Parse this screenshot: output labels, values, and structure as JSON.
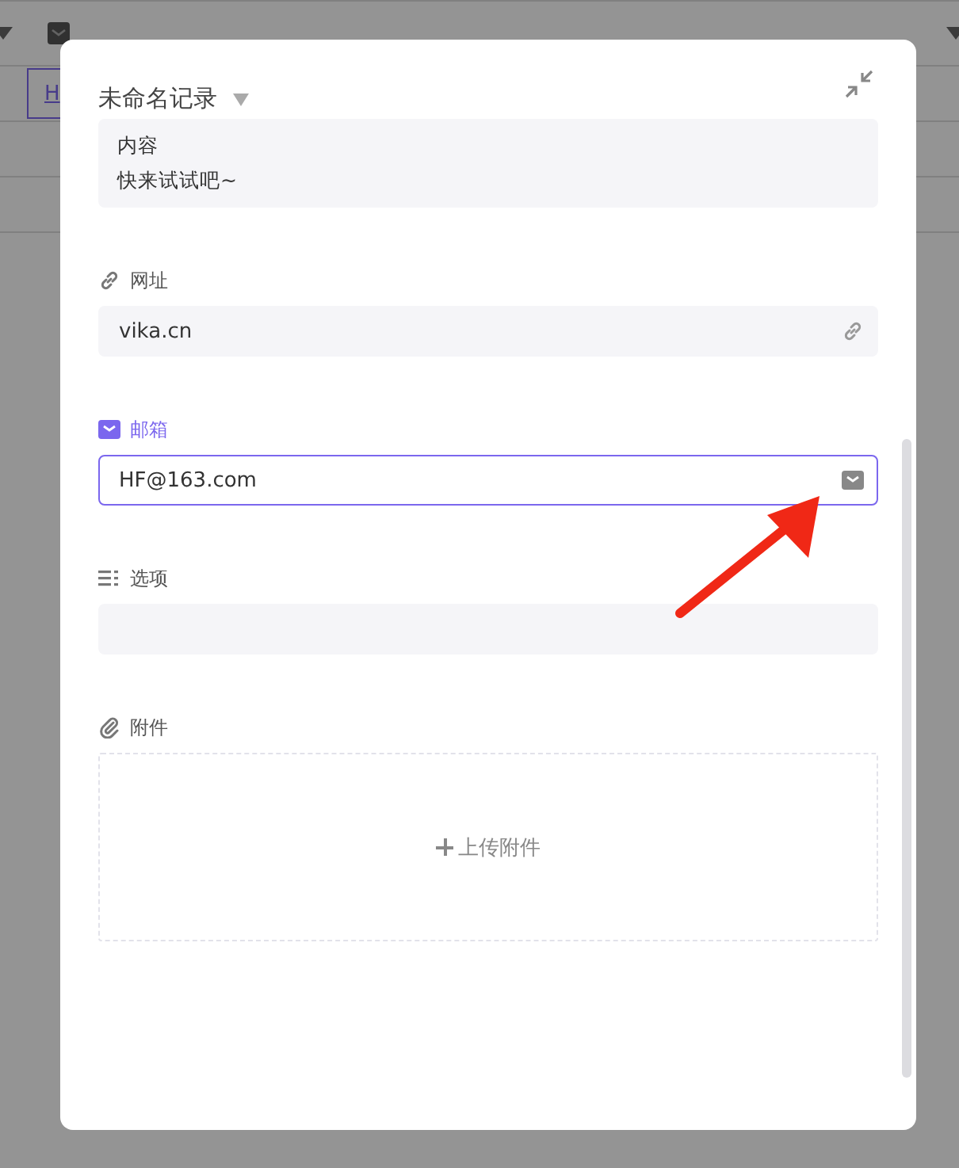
{
  "background_table": {
    "cell_text": "H"
  },
  "record": {
    "title": "未命名记录",
    "content_lines": [
      "内容",
      "快来试试吧~"
    ],
    "fields": [
      {
        "kind": "url",
        "label": "网址",
        "value": "vika.cn",
        "focused": false
      },
      {
        "kind": "email",
        "label": "邮箱",
        "value": "HF@163.com",
        "focused": true
      },
      {
        "kind": "select",
        "label": "选项",
        "focused": false
      },
      {
        "kind": "attachment",
        "label": "附件",
        "upload_label": "上传附件",
        "focused": false
      }
    ]
  }
}
